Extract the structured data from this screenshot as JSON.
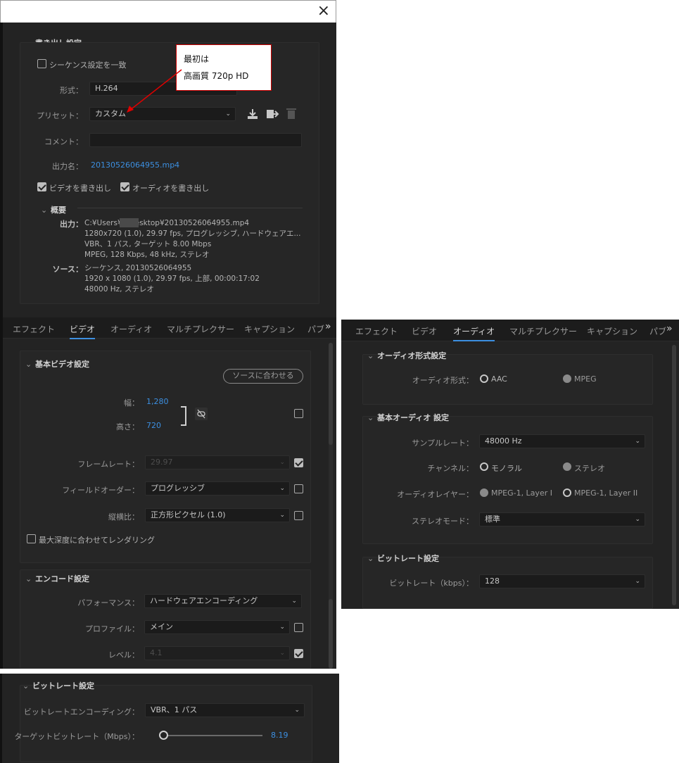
{
  "window": {
    "close_label": "×"
  },
  "export": {
    "section_title": "書き出し設定",
    "match_sequence_label": "シーケンス設定を一致",
    "format_label": "形式：",
    "format_value": "H.264",
    "preset_label": "プリセット：",
    "preset_value": "カスタム",
    "comment_label": "コメント：",
    "output_name_label": "出力名：",
    "output_name_value": "20130526064955.mp4",
    "export_video_label": "ビデオを書き出し",
    "export_audio_label": "オーディオを書き出し",
    "summary_title": "概要",
    "output_label": "出力：",
    "output_lines": [
      "C:¥Users¥      ¥Desktop¥20130526064955.mp4",
      "1280x720 (1.0), 29.97 fps, プログレッシブ, ハードウェアエ...",
      "VBR、1 パス, ターゲット 8.00 Mbps",
      "MPEG, 128 Kbps, 48 kHz, ステレオ"
    ],
    "source_label": "ソース：",
    "source_lines": [
      "シーケンス, 20130526064955",
      "1920 x 1080 (1.0), 29.97 fps, 上部, 00:00:17:02",
      "48000  Hz, ステレオ"
    ]
  },
  "callout": {
    "line1": "最初は",
    "line2": "高画質 720p HD"
  },
  "tabs": [
    "エフェクト",
    "ビデオ",
    "オーディオ",
    "マルチプレクサー",
    "キャプション",
    "パブ"
  ],
  "tabs_overflow": "»",
  "video": {
    "basic_title": "基本ビデオ設定",
    "match_source_label": "ソースに合わせる",
    "width_label": "幅：",
    "width_value": "1,280",
    "height_label": "高さ：",
    "height_value": "720",
    "framerate_label": "フレームレート：",
    "framerate_value": "29.97",
    "field_order_label": "フィールドオーダー：",
    "field_order_value": "プログレッシブ",
    "aspect_label": "縦横比：",
    "aspect_value": "正方形ピクセル (1.0)",
    "max_depth_label": "最大深度に合わせてレンダリング",
    "encode_title": "エンコード設定",
    "performance_label": "パフォーマンス：",
    "performance_value": "ハードウェアエンコーディング",
    "profile_label": "プロファイル：",
    "profile_value": "メイン",
    "level_label": "レベル：",
    "level_value": "4.1"
  },
  "bitrate_panel": {
    "title": "ビットレート設定",
    "encoding_label": "ビットレートエンコーディング：",
    "encoding_value": "VBR、1 パス",
    "target_label": "ターゲットビットレート（Mbps）：",
    "target_value": "8.19",
    "target_fraction": 0.02
  },
  "audio": {
    "format_title": "オーディオ形式設定",
    "format_label": "オーディオ形式：",
    "format_aac": "AAC",
    "format_mpeg": "MPEG",
    "basic_title": "基本オーディオ 設定",
    "sample_rate_label": "サンプルレート：",
    "sample_rate_value": "48000 Hz",
    "channel_label": "チャンネル：",
    "channel_mono": "モノラル",
    "channel_stereo": "ステレオ",
    "layer_label": "オーディオレイヤー：",
    "layer_1": "MPEG-1, Layer I",
    "layer_2": "MPEG-1, Layer II",
    "stereo_mode_label": "ステレオモード：",
    "stereo_mode_value": "標準",
    "bitrate_title": "ビットレート設定",
    "bitrate_label": "ビットレート（kbps）：",
    "bitrate_value": "128"
  },
  "colors": {
    "accent": "#3c8fe0",
    "panel": "#232323",
    "callout_border": "#cc0000",
    "arrow": "#e00000"
  }
}
